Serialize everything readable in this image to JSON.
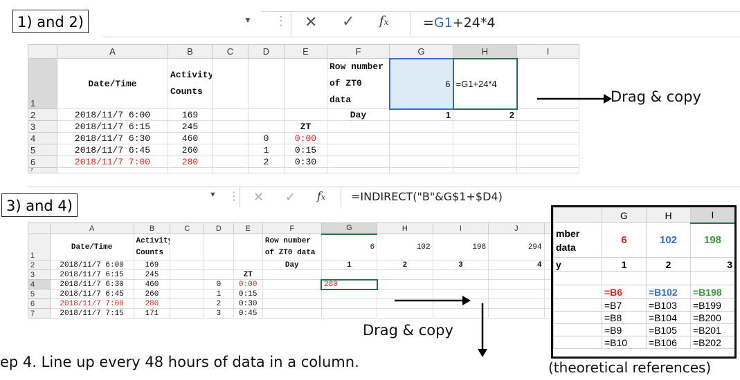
{
  "step12": {
    "label": "1) and 2)",
    "formula": "=G1+24*4",
    "formula_ref": "G1",
    "formula_rest": "+24*4",
    "drag_label": "Drag & copy",
    "columns": [
      "A",
      "B",
      "C",
      "D",
      "E",
      "F",
      "G",
      "H",
      "I"
    ],
    "rows": [
      "1",
      "2",
      "3",
      "4",
      "5",
      "6",
      "7"
    ],
    "header": {
      "date_time": "Date/Time",
      "activity_1": "Activity",
      "activity_2": "Counts",
      "row_number_1": "Row number",
      "row_number_2": "of ZT0 data",
      "day": "Day",
      "g1": "6",
      "h1": "=G1+24*4",
      "g2": "1",
      "h2": "2",
      "zt": "ZT"
    },
    "data": [
      {
        "date": "2018/11/7 6:00",
        "count": "169",
        "d": "",
        "e": ""
      },
      {
        "date": "2018/11/7 6:15",
        "count": "245",
        "d": "",
        "e": ""
      },
      {
        "date": "2018/11/7 6:30",
        "count": "460",
        "d": "0",
        "e": "0:00"
      },
      {
        "date": "2018/11/7 6:45",
        "count": "260",
        "d": "1",
        "e": "0:15"
      },
      {
        "date": "2018/11/7 7:00",
        "count": "280",
        "d": "2",
        "e": "0:30"
      }
    ]
  },
  "step34": {
    "label": "3) and 4)",
    "formula": "=INDIRECT(\"B\"&G$1+$D4)",
    "drag_label": "Drag & copy",
    "columns": [
      "A",
      "B",
      "C",
      "D",
      "E",
      "F",
      "G",
      "H",
      "I",
      "J"
    ],
    "rows": [
      "1",
      "2",
      "3",
      "4",
      "5",
      "6",
      "7"
    ],
    "header": {
      "date_time": "Date/Time",
      "activity_1": "Activity",
      "activity_2": "Counts",
      "row_number_1": "Row number",
      "row_number_2": "of ZT0 data",
      "day": "Day",
      "row1_vals": [
        "6",
        "102",
        "198",
        "294"
      ],
      "day_vals": [
        "1",
        "2",
        "3",
        "4"
      ],
      "zt": "ZT",
      "g4": "280"
    },
    "data": [
      {
        "date": "2018/11/7 6:00",
        "count": "169",
        "d": "",
        "e": ""
      },
      {
        "date": "2018/11/7 6:15",
        "count": "245",
        "d": "",
        "e": ""
      },
      {
        "date": "2018/11/7 6:30",
        "count": "460",
        "d": "0",
        "e": "0:00"
      },
      {
        "date": "2018/11/7 6:45",
        "count": "260",
        "d": "1",
        "e": "0:15"
      },
      {
        "date": "2018/11/7 7:00",
        "count": "280",
        "d": "2",
        "e": "0:30"
      },
      {
        "date": "2018/11/7 7:15",
        "count": "171",
        "d": "3",
        "e": "0:45"
      }
    ]
  },
  "theoretical": {
    "columns": [
      "G",
      "H",
      "I"
    ],
    "row_labels": [
      "mber",
      "data",
      "y"
    ],
    "row1": [
      "6",
      "102",
      "198"
    ],
    "day": [
      "1",
      "2",
      "3"
    ],
    "refs": [
      [
        "=B6",
        "=B102",
        "=B198"
      ],
      [
        "=B7",
        "=B103",
        "=B199"
      ],
      [
        "=B8",
        "=B104",
        "=B200"
      ],
      [
        "=B9",
        "=B105",
        "=B201"
      ],
      [
        "=B10",
        "=B106",
        "=B202"
      ]
    ],
    "colors": [
      "#e0201b",
      "#2f6fc6",
      "#3a9a3a"
    ],
    "caption": "(theoretical references)"
  },
  "caption_step4": "ep 4. Line up every 48 hours of data in a column."
}
